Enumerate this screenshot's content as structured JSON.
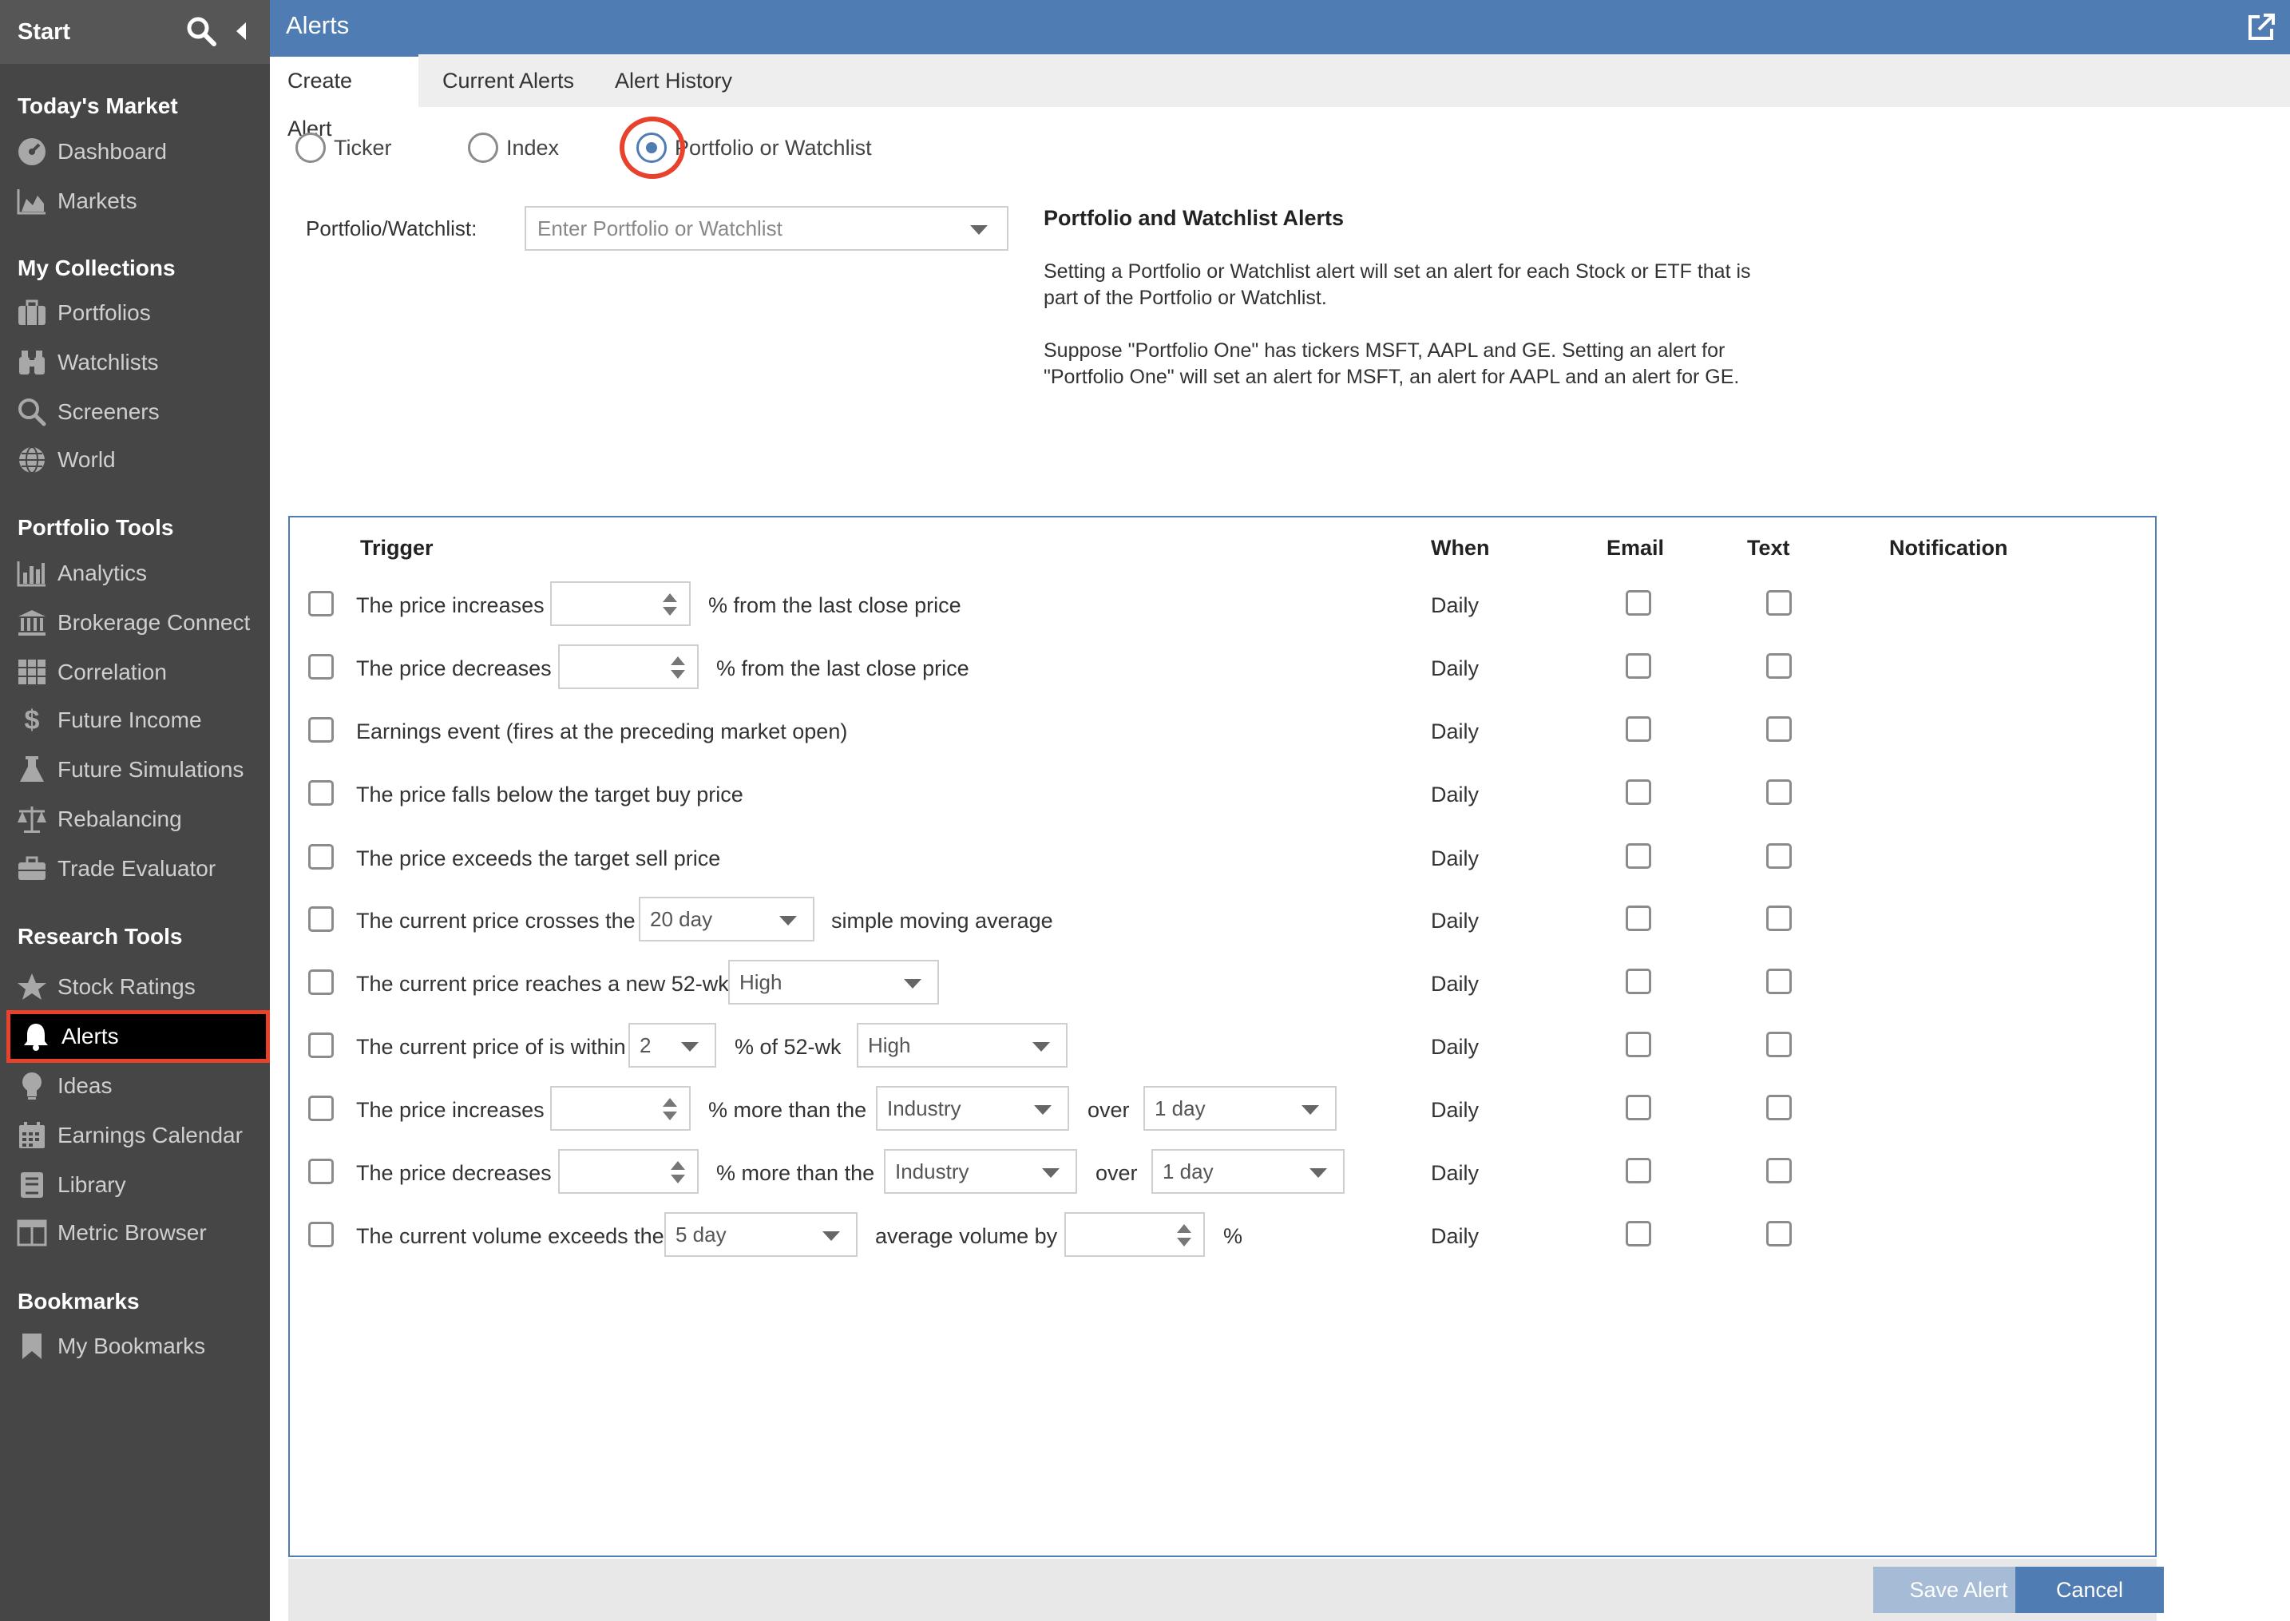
{
  "sidebar": {
    "start": "Start",
    "sections": {
      "todays_market": "Today's Market",
      "my_collections": "My Collections",
      "portfolio_tools": "Portfolio Tools",
      "research_tools": "Research Tools",
      "bookmarks": "Bookmarks"
    },
    "items": {
      "dashboard": "Dashboard",
      "markets": "Markets",
      "portfolios": "Portfolios",
      "watchlists": "Watchlists",
      "screeners": "Screeners",
      "world": "World",
      "analytics": "Analytics",
      "brokerage_connect": "Brokerage Connect",
      "correlation": "Correlation",
      "future_income": "Future Income",
      "future_simulations": "Future Simulations",
      "rebalancing": "Rebalancing",
      "trade_evaluator": "Trade Evaluator",
      "stock_ratings": "Stock Ratings",
      "alerts": "Alerts",
      "ideas": "Ideas",
      "earnings_calendar": "Earnings Calendar",
      "library": "Library",
      "metric_browser": "Metric Browser",
      "my_bookmarks": "My Bookmarks"
    }
  },
  "header": {
    "title": "Alerts"
  },
  "tabs": {
    "create": "Create Alert",
    "current": "Current Alerts",
    "history": "Alert History"
  },
  "radios": {
    "ticker": "Ticker",
    "index": "Index",
    "portfolio": "Portfolio or Watchlist",
    "selected": "portfolio"
  },
  "portfolio_field": {
    "label": "Portfolio/Watchlist:",
    "placeholder": "Enter Portfolio or Watchlist"
  },
  "info": {
    "title": "Portfolio and Watchlist Alerts",
    "p1_line1": "Setting a Portfolio or Watchlist alert will set an alert for each Stock or ETF that is",
    "p1_line2": "part of the Portfolio or Watchlist.",
    "p2_line1": "Suppose \"Portfolio One\" has tickers MSFT, AAPL and GE. Setting an alert for",
    "p2_line2": "\"Portfolio One\" will set an alert for MSFT, an alert for AAPL and an alert for GE."
  },
  "table": {
    "headers": {
      "trigger": "Trigger",
      "when": "When",
      "email": "Email",
      "text": "Text",
      "notification": "Notification"
    },
    "when_value": "Daily",
    "rows": {
      "r1": {
        "a": "The price increases",
        "b": "% from the last close price"
      },
      "r2": {
        "a": "The price decreases",
        "b": "% from the last close price"
      },
      "r3": {
        "a": "Earnings event (fires at the preceding market open)"
      },
      "r4": {
        "a": "The price falls below the target buy price"
      },
      "r5": {
        "a": "The price exceeds the target sell price"
      },
      "r6": {
        "a": "The current price crosses the",
        "sel": "20 day",
        "b": "simple moving average"
      },
      "r7": {
        "a": "The current price reaches a new 52-wk",
        "sel": "High"
      },
      "r8": {
        "a": "The current price of is within",
        "sel1": "2",
        "b": "% of 52-wk",
        "sel2": "High"
      },
      "r9": {
        "a": "The price increases",
        "b": "% more than the",
        "sel1": "Industry",
        "c": "over",
        "sel2": "1 day"
      },
      "r10": {
        "a": "The price decreases",
        "b": "% more than the",
        "sel1": "Industry",
        "c": "over",
        "sel2": "1 day"
      },
      "r11": {
        "a": "The current volume exceeds the",
        "sel1": "5 day",
        "b": "average volume by",
        "c": "%"
      }
    }
  },
  "buttons": {
    "save": "Save Alert",
    "cancel": "Cancel"
  },
  "colors": {
    "accent": "#4f7db3",
    "highlight": "#e8412c",
    "sidebar": "#464646"
  }
}
